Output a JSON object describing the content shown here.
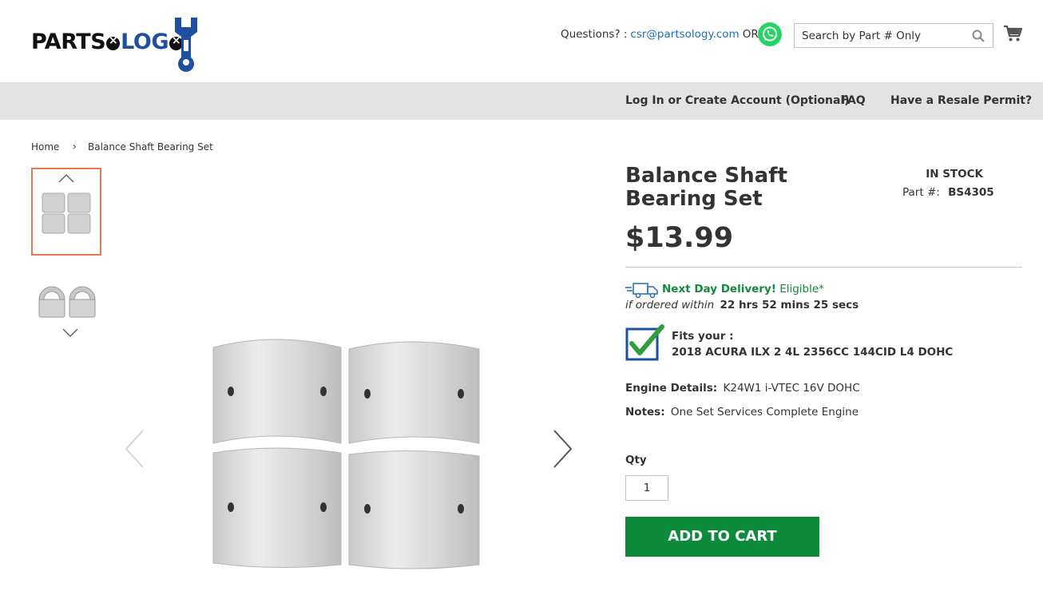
{
  "header": {
    "logo_text_1": "PARTS",
    "logo_text_2": "LOG",
    "questions_label": "Questions? :",
    "email": "csr@partsology.com",
    "or_label": "OR:",
    "whatsapp_icon": "whatsapp-icon",
    "search_placeholder": "Search by Part # Only",
    "search_icon": "search-icon",
    "cart_icon": "cart-icon"
  },
  "nav": {
    "items": [
      {
        "label": "Log In or Create Account (Optional)"
      },
      {
        "label": "FAQ"
      },
      {
        "label": "Have a Resale Permit?"
      }
    ]
  },
  "breadcrumb": {
    "home": "Home",
    "current": "Balance Shaft Bearing Set"
  },
  "gallery": {
    "prev_icon": "chevron-up-icon",
    "next_icon": "chevron-down-icon",
    "main_prev_icon": "chevron-left-icon",
    "main_next_icon": "chevron-right-icon"
  },
  "product": {
    "title": "Balance Shaft Bearing Set",
    "stock": "IN STOCK",
    "part_label": "Part #:",
    "part_number": "BS4305",
    "price": "$13.99",
    "delivery_title": "Next Day Delivery!",
    "delivery_eligible": "Eligible*",
    "within_label": "if ordered within",
    "countdown": "22 hrs 52 mins 25 secs",
    "fits_label": "Fits your :",
    "fits_vehicle": "2018 ACURA ILX 2 4L 2356CC 144CID L4 DOHC",
    "engine_label": "Engine Details:",
    "engine_value": "K24W1 i-VTEC 16V DOHC",
    "notes_label": "Notes:",
    "notes_value": "One Set Services Complete Engine",
    "qty_label": "Qty",
    "qty_value": "1",
    "add_to_cart": "ADD TO CART"
  },
  "colors": {
    "accent_green": "#0c8b3a",
    "link_blue": "#1f6fb5",
    "thumb_active_border": "#e8784f",
    "nav_bg": "#e3e3e3"
  }
}
